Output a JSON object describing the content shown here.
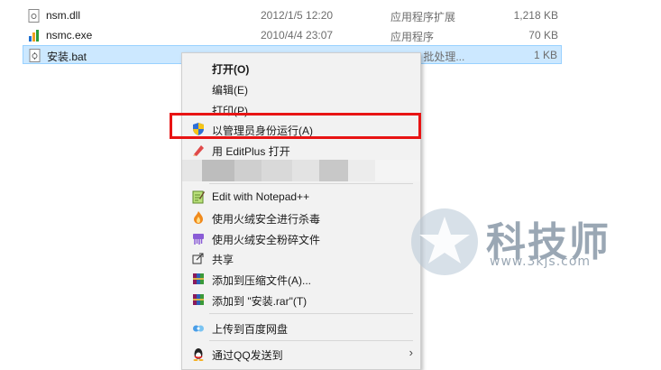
{
  "files": [
    {
      "name": "nsm.dll",
      "date": "2012/1/5 12:20",
      "type": "应用程序扩展",
      "size": "1,218 KB",
      "icon": "dll-file-icon"
    },
    {
      "name": "nsmc.exe",
      "date": "2010/4/4 23:07",
      "type": "应用程序",
      "size": "70 KB",
      "icon": "exe-file-icon"
    },
    {
      "name": "安装.bat",
      "date": "",
      "type": "Wi    ws 批处理...",
      "size": "1 KB",
      "icon": "bat-file-icon"
    }
  ],
  "menu": {
    "open": "打开(O)",
    "edit": "编辑(E)",
    "print": "打印(P)",
    "run_as_admin": "以管理员身份运行(A)",
    "editplus": "用 EditPlus 打开",
    "notepadpp": "Edit with Notepad++",
    "huorong_scan": "使用火绒安全进行杀毒",
    "huorong_shred": "使用火绒安全粉碎文件",
    "share": "共享",
    "add_archive": "添加到压缩文件(A)...",
    "add_rar": "添加到 \"安装.rar\"(T)",
    "baidu_upload": "上传到百度网盘",
    "qq_send": "通过QQ发送到"
  },
  "watermark": {
    "title": "科技师",
    "url": "www.3kjs.com"
  },
  "colors": {
    "selection": "#cce8ff",
    "highlight_border": "#e81414",
    "menu_bg": "#f2f2f2"
  }
}
